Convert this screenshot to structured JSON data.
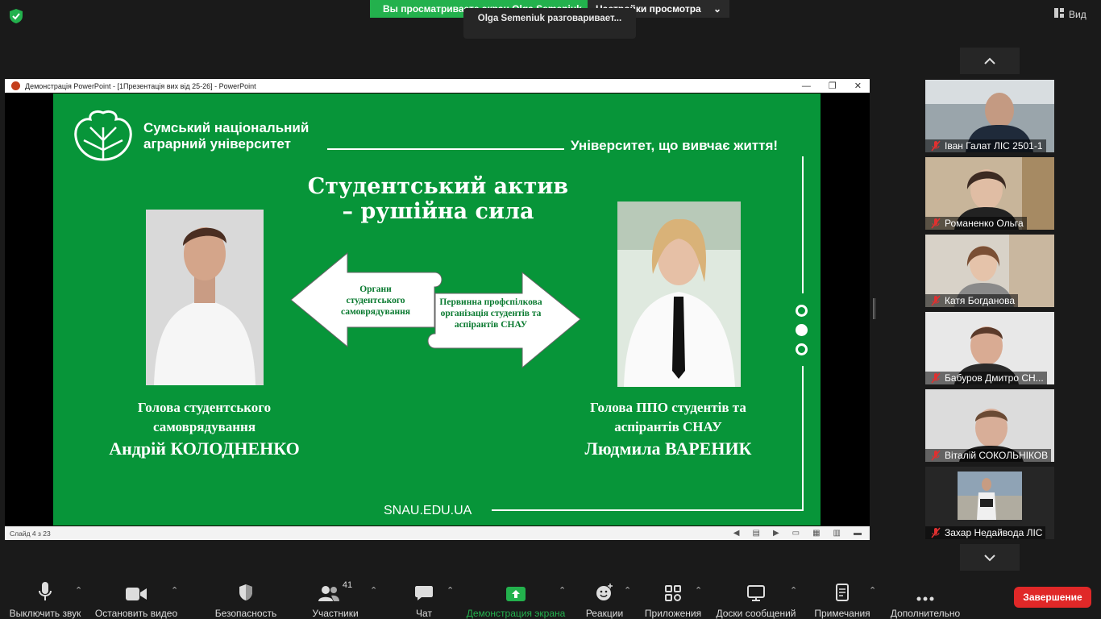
{
  "top": {
    "sharing_text": "Вы просматриваете экран Olga Semeniuk",
    "view_settings": "Настройки просмотра",
    "speaking": "Olga Semeniuk разговаривает...",
    "view_label": "Вид"
  },
  "ppt": {
    "window_title": "Демонстрація PowerPoint - [1Презентація вих від 25-26] - PowerPoint",
    "status": "Слайд 4 з 23"
  },
  "slide": {
    "university_line1": "Сумський національний",
    "university_line2": "аграрний університет",
    "motto": "Університет, що вивчає життя!",
    "title_line1": "Студентський актив",
    "title_line2": "– рушійна сила",
    "arrow_left_text": "Органи студентського самоврядування",
    "arrow_right_text": "Первинна профспілкова організація студентів та аспірантів СНАУ",
    "left_caption_line1": "Голова студентського",
    "left_caption_line2": "самоврядування",
    "left_name": "Андрій КОЛОДНЕНКО",
    "right_caption_line1": "Голова ППО студентів та",
    "right_caption_line2": "аспірантів СНАУ",
    "right_name": "Людмила ВАРЕНИК",
    "url": "SNAU.EDU.UA"
  },
  "participants": [
    {
      "name": "Іван Галат ЛІС 2501-1"
    },
    {
      "name": "Романенко Ольга"
    },
    {
      "name": "Катя Богданова"
    },
    {
      "name": "Бабуров Дмитро СН..."
    },
    {
      "name": "Віталій СОКОЛЬНІКОВ"
    },
    {
      "name": "Захар Недайвода ЛІС"
    }
  ],
  "toolbar": {
    "mute": "Выключить звук",
    "video": "Остановить видео",
    "security": "Безопасность",
    "participants": "Участники",
    "participants_count": "41",
    "chat": "Чат",
    "share": "Демонстрация экрана",
    "reactions": "Реакции",
    "apps": "Приложения",
    "whiteboards": "Доски сообщений",
    "notes": "Примечания",
    "more": "Дополнительно",
    "end": "Завершение"
  },
  "colors": {
    "slide_green": "#079539",
    "share_green": "#23b14d",
    "end_red": "#e02828"
  }
}
